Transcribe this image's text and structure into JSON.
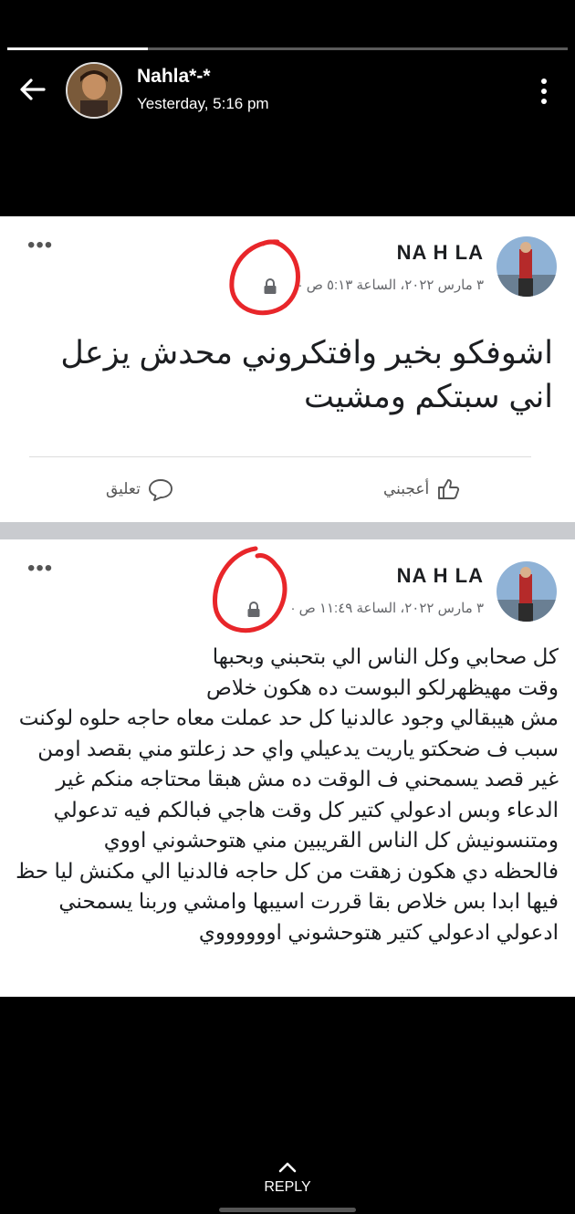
{
  "status": {
    "sender_name": "Nahla*-*",
    "timestamp": "Yesterday, 5:16 pm",
    "progress": 0.25
  },
  "posts": [
    {
      "author": "NA H LA",
      "meta": "٣ مارس ٢٠٢٢، الساعة ٥:١٣ ص ·",
      "privacy_icon": "lock-icon",
      "lines": [
        "اشوفكو بخير وافتكروني محدش يزعل",
        "اني سبتكم ومشيت"
      ],
      "like_label": "أعجبني",
      "comment_label": "تعليق"
    },
    {
      "author": "NA H LA",
      "meta": "٣ مارس ٢٠٢٢، الساعة ١١:٤٩ ص ·",
      "privacy_icon": "lock-icon",
      "lines": [
        "كل صحابي وكل الناس الي بتحبني وبحبها",
        "وقت مهيظهرلكو البوست ده هكون خلاص",
        "مش هيبقالي وجود عالدنيا كل حد عملت معاه حاجه حلوه لوكنت",
        "سبب ف ضحكتو ياريت يدعيلي واي حد زعلتو مني بقصد اومن",
        "غير قصد يسمحني  ف الوقت ده مش هبقا محتاجه منكم غير",
        "الدعاء وبس ادعولي كتير كل وقت هاجي فبالكم فيه تدعولي",
        "ومتنسونيش كل الناس القريبين مني هتوحشوني اووي",
        "فالحظه دي هكون زهقت من كل حاجه فالدنيا الي مكنش ليا حظ",
        "فيها ابدا بس خلاص بقا قررت اسيبها وامشي وربنا يسمحني",
        "ادعولي ادعولي كتير هتوحشوني اووووووي"
      ]
    }
  ],
  "reply": {
    "label": "REPLY"
  },
  "colors": {
    "annotation_circle": "#e8262a",
    "separator": "#c9cbcf"
  }
}
